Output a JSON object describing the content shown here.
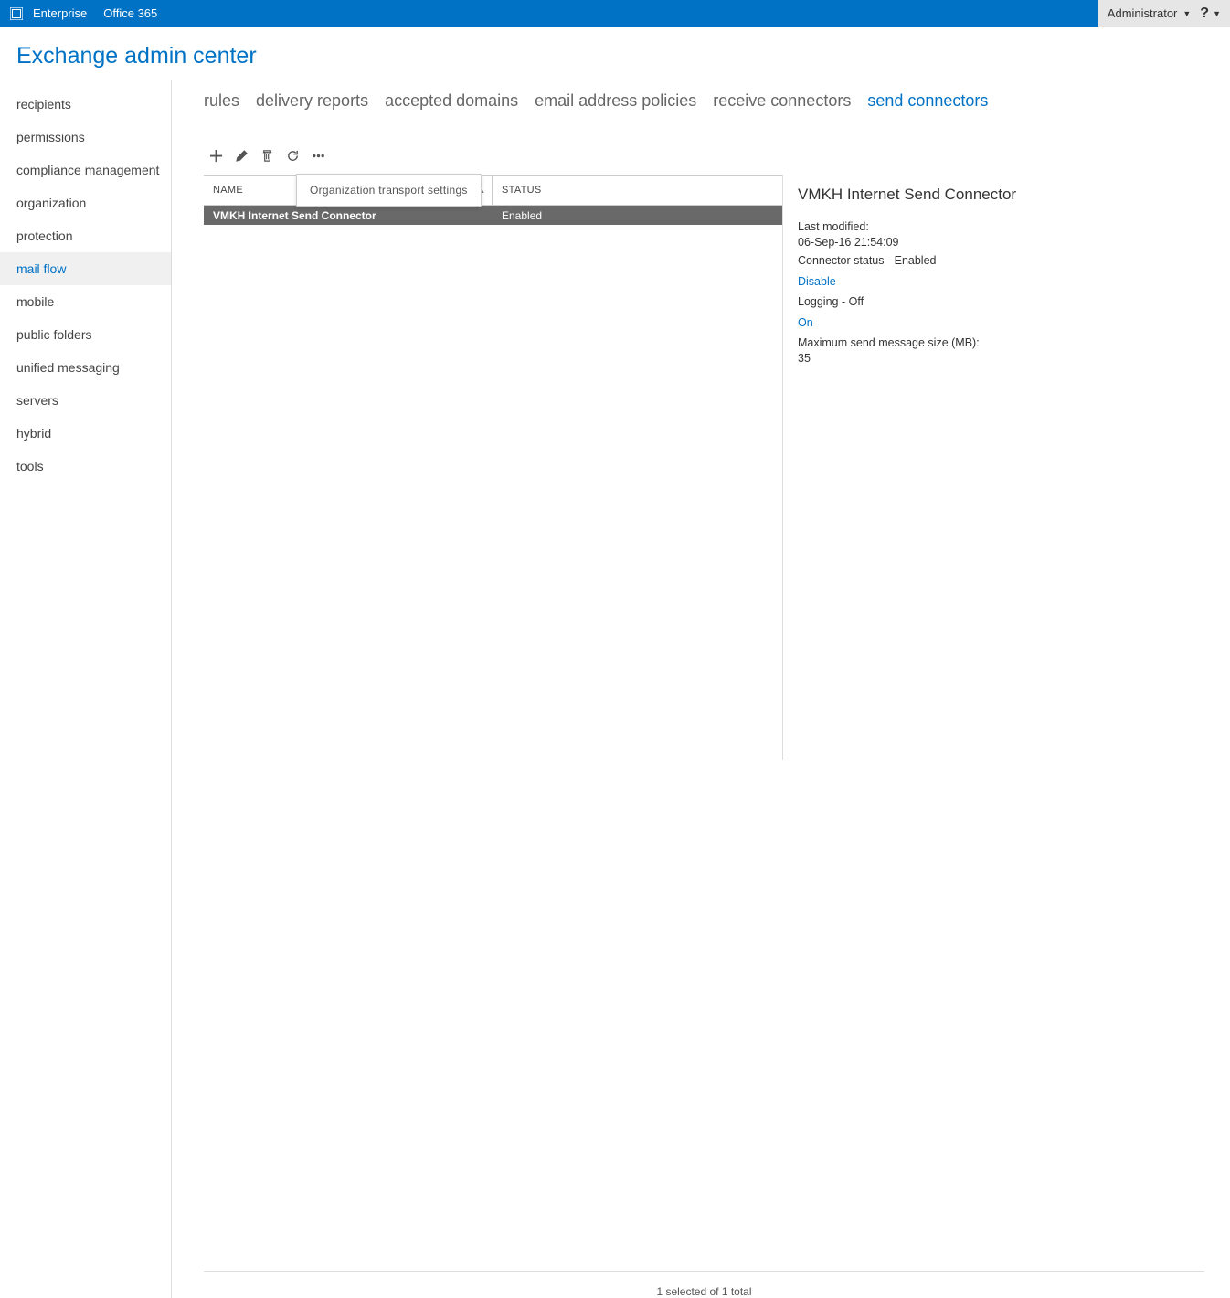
{
  "topbar": {
    "link1": "Enterprise",
    "link2": "Office 365",
    "user": "Administrator"
  },
  "title": "Exchange admin center",
  "sidebar": {
    "items": [
      {
        "label": "recipients"
      },
      {
        "label": "permissions"
      },
      {
        "label": "compliance management"
      },
      {
        "label": "organization"
      },
      {
        "label": "protection"
      },
      {
        "label": "mail flow"
      },
      {
        "label": "mobile"
      },
      {
        "label": "public folders"
      },
      {
        "label": "unified messaging"
      },
      {
        "label": "servers"
      },
      {
        "label": "hybrid"
      },
      {
        "label": "tools"
      }
    ]
  },
  "tooltip": "Organization transport settings",
  "tabs": [
    {
      "label": "rules"
    },
    {
      "label": "delivery reports"
    },
    {
      "label": "accepted domains"
    },
    {
      "label": "email address policies"
    },
    {
      "label": "receive connectors"
    },
    {
      "label": "send connectors"
    }
  ],
  "table": {
    "headers": {
      "name": "NAME",
      "status": "STATUS"
    },
    "rows": [
      {
        "name": "VMKH Internet Send Connector",
        "status": "Enabled"
      }
    ]
  },
  "details": {
    "title": "VMKH Internet Send Connector",
    "modified_label": "Last modified:",
    "modified_value": "06-Sep-16 21:54:09",
    "status": "Connector status - Enabled",
    "disable": "Disable",
    "logging": "Logging - Off",
    "on": "On",
    "maxsize_label": "Maximum send message size (MB):",
    "maxsize_value": "35"
  },
  "footer": "1 selected of 1 total"
}
